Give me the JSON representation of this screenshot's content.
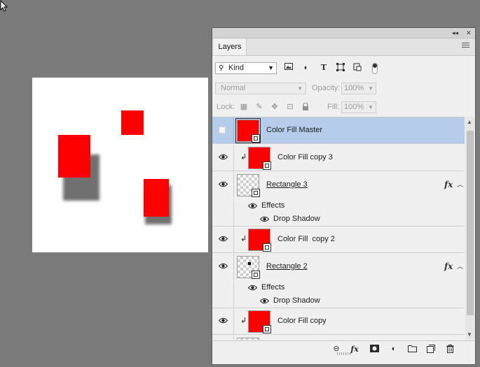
{
  "panel": {
    "tab_label": "Layers",
    "collapse_label": "◂◂",
    "close_label": "✕"
  },
  "filter": {
    "kind_label": "Kind",
    "icons": [
      "image-filter-icon",
      "adjustment-filter-icon",
      "type-filter-icon",
      "shape-filter-icon",
      "smart-object-filter-icon"
    ]
  },
  "blend": {
    "mode": "Normal",
    "opacity_label": "Opacity:",
    "opacity_value": "100%"
  },
  "lock": {
    "label": "Lock:",
    "fill_label": "Fill:",
    "fill_value": "100%"
  },
  "layers": [
    {
      "name": "Color Fill Master",
      "type": "fill",
      "visible": false,
      "selected": true,
      "clipped": false
    },
    {
      "name": "Color Fill copy 3",
      "type": "fill",
      "visible": true,
      "selected": false,
      "clipped": true
    },
    {
      "name": "Rectangle 3",
      "type": "shape",
      "visible": true,
      "selected": false,
      "clipped": false,
      "fx": "fx",
      "effects_label": "Effects",
      "effect": "Drop Shadow"
    },
    {
      "name": "Color Fill  copy 2",
      "type": "fill",
      "visible": true,
      "selected": false,
      "clipped": true
    },
    {
      "name": "Rectangle 2",
      "type": "shape",
      "visible": true,
      "selected": false,
      "clipped": false,
      "fx": "fx",
      "effects_label": "Effects",
      "effect": "Drop Shadow"
    },
    {
      "name": "Color Fill copy",
      "type": "fill",
      "visible": true,
      "selected": false,
      "clipped": true
    }
  ],
  "footer_icons": [
    "link-layers-icon",
    "fx-icon",
    "layer-mask-icon",
    "adjustment-layer-icon",
    "group-folder-icon",
    "new-layer-icon",
    "delete-trash-icon"
  ],
  "footer_fx_label": "fx",
  "colors": {
    "fill": "#ff0000",
    "selection": "#b5ccea",
    "workspace": "#7a7a7a",
    "panel": "#f0f0f0"
  }
}
